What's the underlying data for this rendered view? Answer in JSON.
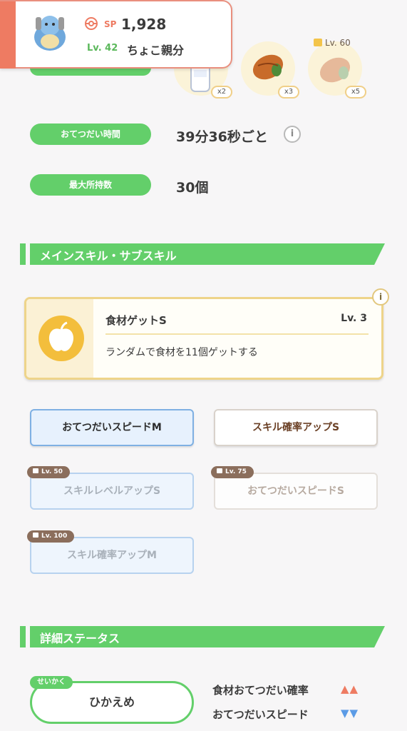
{
  "header": {
    "sp_label": "SP",
    "sp_value": "1,928",
    "level": "Lv. 42",
    "name": "ちょこ親分"
  },
  "ingredients": [
    {
      "name": "milk-icon",
      "qty": "x2"
    },
    {
      "name": "cacao-icon",
      "qty": "x3"
    },
    {
      "name": "cacao-locked-icon",
      "qty": "x5",
      "unlock_level": "Lv. 60"
    }
  ],
  "info": {
    "help_time_label": "おてつだい時間",
    "help_time_value": "39分36秒ごと",
    "max_carry_label": "最大所持数",
    "max_carry_value": "30個"
  },
  "sections": {
    "skills_title": "メインスキル・サブスキル",
    "details_title": "詳細ステータス"
  },
  "main_skill": {
    "name": "食材ゲットS",
    "level": "Lv. 3",
    "description": "ランダムで食材を11個ゲットする"
  },
  "sub_skills": [
    {
      "label": "おてつだいスピードM"
    },
    {
      "label": "スキル確率アップS"
    },
    {
      "label": "スキルレベルアップS",
      "lock": "Lv. 50"
    },
    {
      "label": "おてつだいスピードS",
      "lock": "Lv. 75"
    },
    {
      "label": "スキル確率アップM",
      "lock": "Lv. 100"
    }
  ],
  "nature": {
    "tag": "せいかく",
    "value": "ひかえめ",
    "up_label": "食材おてつだい確率",
    "up_arrows": "▲▲",
    "down_label": "おてつだいスピード",
    "down_arrows": "▼▼"
  },
  "colors": {
    "green": "#63cf6a",
    "up": "#ee7b62",
    "down": "#5b9be6"
  }
}
